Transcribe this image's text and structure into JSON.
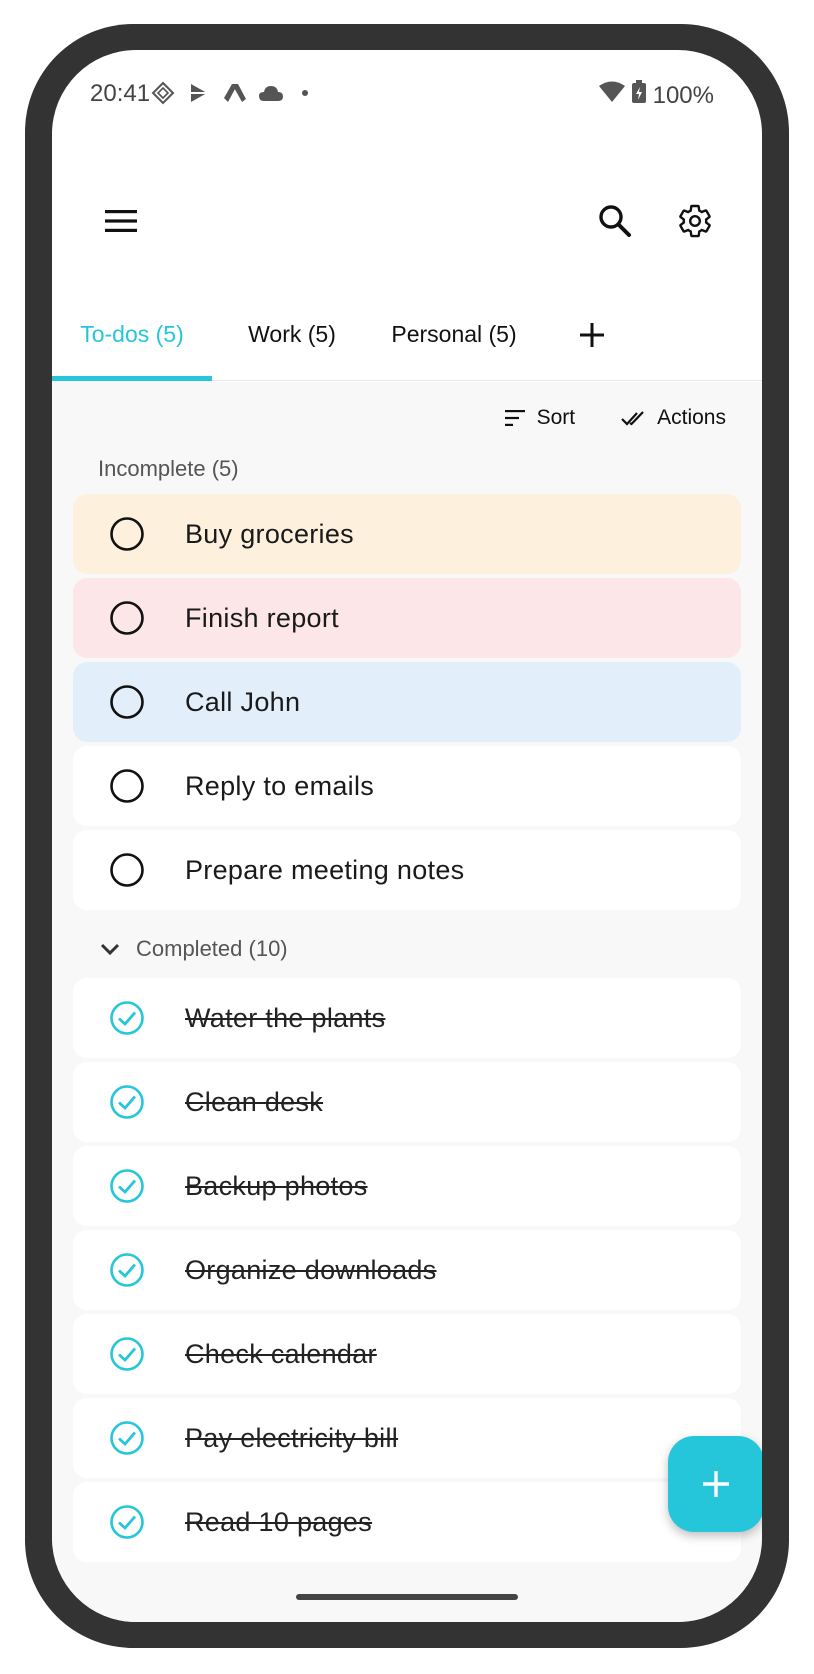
{
  "status_bar": {
    "time": "20:41",
    "icons": [
      "sync-icon",
      "play-store-icon",
      "drive-icon",
      "cloud-icon",
      "dot-icon"
    ],
    "battery_text": "100%"
  },
  "toolbar": {
    "menu_icon": "hamburger-menu-icon",
    "search_icon": "search-icon",
    "settings_icon": "gear-icon"
  },
  "tabs": [
    {
      "label": "To-dos (5)",
      "active": true
    },
    {
      "label": "Work (5)",
      "active": false
    },
    {
      "label": "Personal (5)",
      "active": false
    }
  ],
  "add_tab_label": "+",
  "actions": {
    "sort_label": "Sort",
    "actions_label": "Actions"
  },
  "incomplete": {
    "label": "Incomplete (5)",
    "items": [
      {
        "text": "Buy groceries",
        "color": "#fdf0dc"
      },
      {
        "text": "Finish report",
        "color": "#fde6e8"
      },
      {
        "text": "Call John",
        "color": "#e2effa"
      },
      {
        "text": "Reply to emails",
        "color": "#ffffff"
      },
      {
        "text": "Prepare meeting notes",
        "color": "#ffffff"
      }
    ]
  },
  "completed": {
    "label": "Completed (10)",
    "items": [
      {
        "text": "Water the plants"
      },
      {
        "text": "Clean desk"
      },
      {
        "text": "Backup photos"
      },
      {
        "text": "Organize downloads"
      },
      {
        "text": "Check calendar"
      },
      {
        "text": "Pay electricity bill"
      },
      {
        "text": "Read 10 pages"
      }
    ]
  },
  "accent_color": "#26c6da",
  "fab_icon": "plus-icon"
}
